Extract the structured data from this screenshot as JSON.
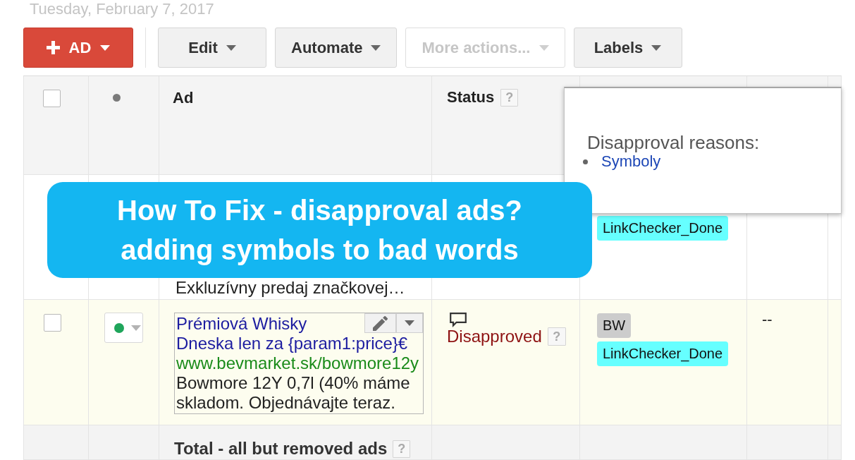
{
  "date": "Tuesday, February 7, 2017",
  "toolbar": {
    "buttons": [
      {
        "label": "AD",
        "kind": "primary",
        "disabled": false
      },
      {
        "label": "Edit",
        "kind": "menu",
        "disabled": false
      },
      {
        "label": "Automate",
        "kind": "menu",
        "disabled": false
      },
      {
        "label": "More actions...",
        "kind": "menu",
        "disabled": true
      },
      {
        "label": "Labels",
        "kind": "menu",
        "disabled": false
      }
    ]
  },
  "table": {
    "header": {
      "checked": false,
      "columns": [
        {
          "label": "Ad"
        },
        {
          "label": "Status",
          "help": "?"
        }
      ]
    },
    "rows": [
      {
        "kind": "partial",
        "highlighted": false,
        "ad": {
          "description": "Exkluzívny predaj značkovej…"
        },
        "labels": [
          {
            "text": "LinkChecker_Done",
            "color": "#66ffff"
          }
        ]
      },
      {
        "kind": "ad",
        "highlighted": true,
        "checked": false,
        "status_dot": {
          "color": "#1fa55b"
        },
        "ad": {
          "headline_1": "Prémiová Whisky",
          "headline_2": "Dneska len za {param1:price}€",
          "display_url": "www.bevmarket.sk/bowmore12y",
          "description": "Bowmore 12Y 0,7l (40% máme skladom. Objednávajte teraz."
        },
        "status": {
          "text": "Disapproved",
          "help": "?"
        },
        "labels": [
          {
            "text": "BW",
            "color": "#cccccc"
          },
          {
            "text": "LinkChecker_Done",
            "color": "#66ffff"
          }
        ],
        "column_6": "--"
      }
    ],
    "total": {
      "label": "Total - all but removed ads",
      "help": "?"
    }
  },
  "popup": {
    "heading": "Disapproval reasons:",
    "items": [
      "Symboly"
    ]
  },
  "banner": {
    "lines": [
      "How To Fix - disapproval ads?",
      "adding symbols to bad words"
    ]
  }
}
